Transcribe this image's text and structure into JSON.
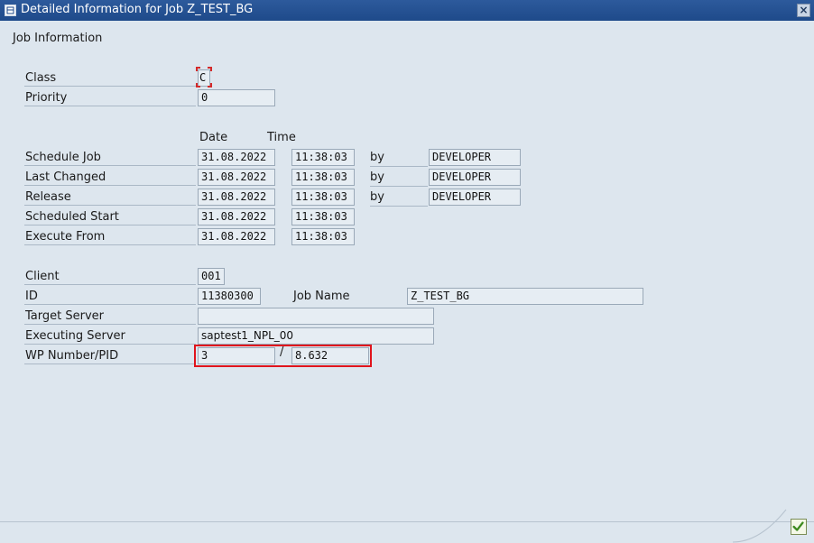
{
  "window": {
    "title": "Detailed Information for Job Z_TEST_BG",
    "close_glyph": "×"
  },
  "section_title": "Job Information",
  "class": {
    "label": "Class",
    "value": "C"
  },
  "priority": {
    "label": "Priority",
    "value": "0"
  },
  "headers": {
    "date": "Date",
    "time": "Time"
  },
  "schedule_rows": [
    {
      "label": "Schedule Job",
      "date": "31.08.2022",
      "time": "11:38:03",
      "by": "by",
      "user": "DEVELOPER"
    },
    {
      "label": "Last Changed",
      "date": "31.08.2022",
      "time": "11:38:03",
      "by": "by",
      "user": "DEVELOPER"
    },
    {
      "label": "Release",
      "date": "31.08.2022",
      "time": "11:38:03",
      "by": "by",
      "user": "DEVELOPER"
    },
    {
      "label": "Scheduled Start",
      "date": "31.08.2022",
      "time": "11:38:03"
    },
    {
      "label": "Execute From",
      "date": "31.08.2022",
      "time": "11:38:03"
    }
  ],
  "client": {
    "label": "Client",
    "value": "001"
  },
  "id": {
    "label": "ID",
    "value": "11380300"
  },
  "job_name": {
    "label": "Job Name",
    "value": "Z_TEST_BG"
  },
  "target_server": {
    "label": "Target Server",
    "value": ""
  },
  "executing_server": {
    "label": "Executing Server",
    "value": "saptest1_NPL_00"
  },
  "wp_pid": {
    "label": "WP Number/PID",
    "wp": "3",
    "separator": "/",
    "pid": "8.632"
  },
  "icons": {
    "title": "window-menu-icon",
    "ok": "checkmark-icon",
    "close": "close-icon"
  },
  "colors": {
    "titlebar": "#1e4a8a",
    "background": "#dde6ee",
    "highlight": "#e0141c",
    "focus": "#d42a2a"
  }
}
